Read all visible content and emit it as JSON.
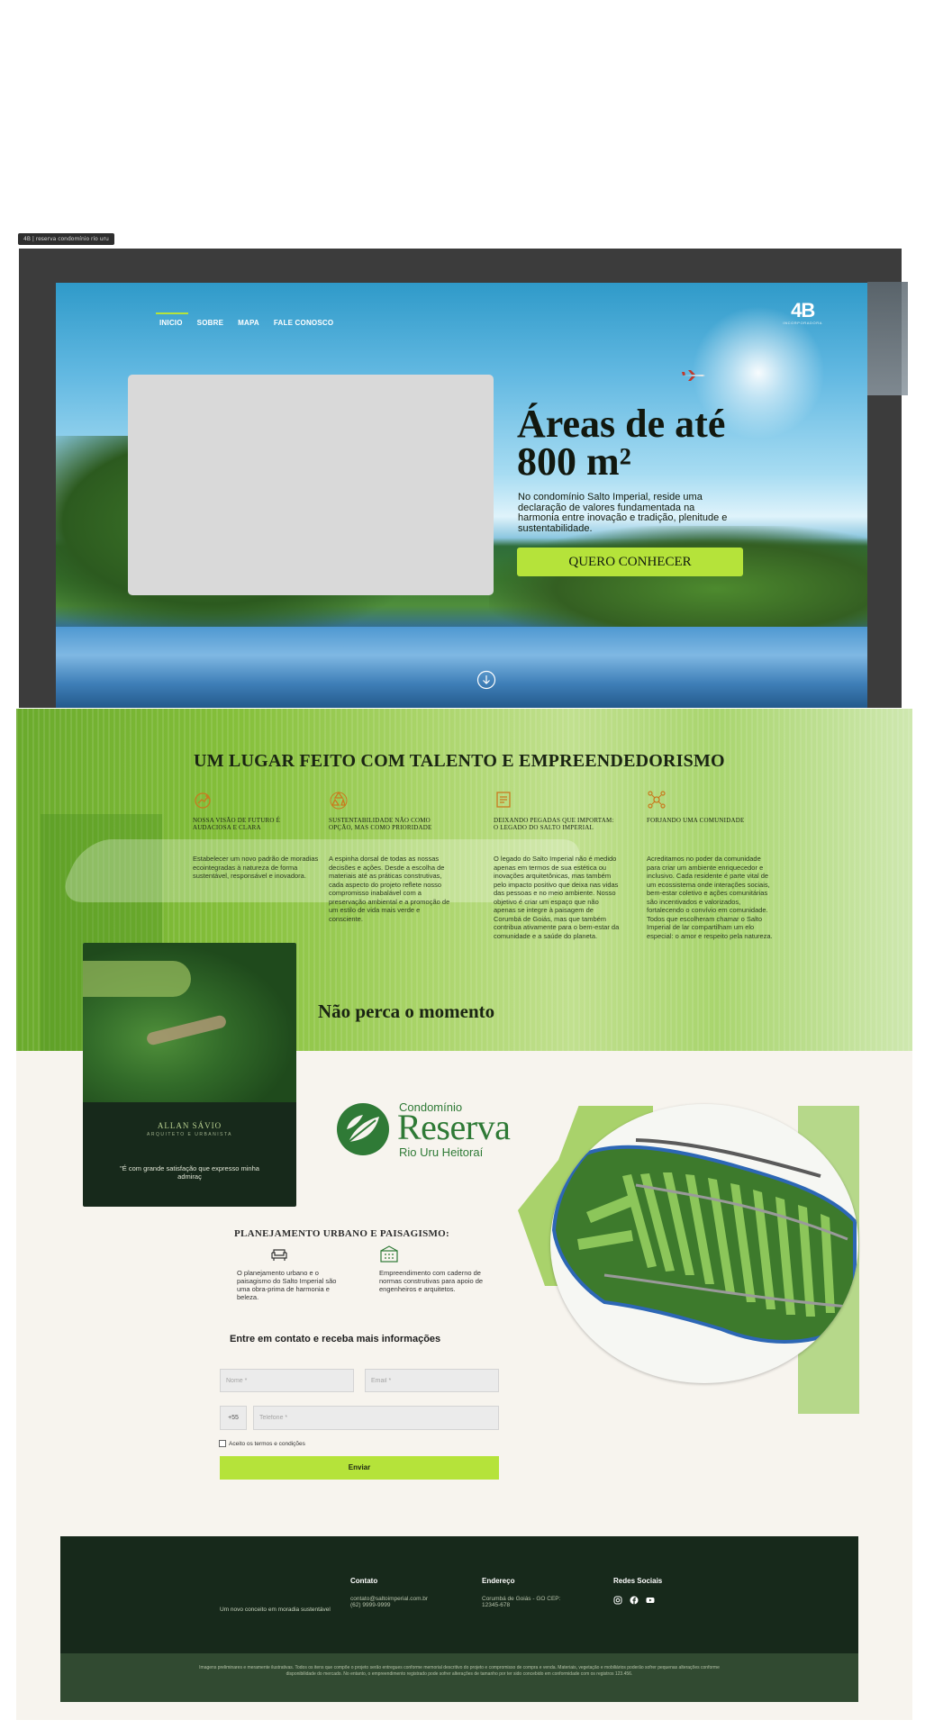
{
  "frame_tag": "4B | reserva condomínio rio uru",
  "nav": {
    "items": [
      {
        "label": "INICIO",
        "active": true
      },
      {
        "label": "SOBRE",
        "active": false
      },
      {
        "label": "MAPA",
        "active": false
      },
      {
        "label": "FALE CONOSCO",
        "active": false
      }
    ]
  },
  "logo": {
    "mark": "4B",
    "sub": "INCORPORADORA"
  },
  "hero": {
    "title_line1": "Áreas de até",
    "title_line2": "800 m²",
    "text": "No condomínio Salto Imperial, reside uma declaração de valores fundamentada na harmonia entre inovação e tradição, plenitude e sustentabilidade.",
    "cta": "QUERO CONHECER"
  },
  "talent": {
    "title": "UM LUGAR FEITO COM TALENTO E EMPREENDEDORISMO",
    "pillars": [
      {
        "icon": "growth-icon",
        "title": "NOSSA VISÃO DE FUTURO É AUDACIOSA E CLARA",
        "body": "Estabelecer um novo padrão de moradias ecointegradas à natureza de forma sustentável, responsável e inovadora."
      },
      {
        "icon": "recycle-icon",
        "title": "SUSTENTABILIDADE NÃO COMO OPÇÃO, MAS COMO PRIORIDADE",
        "body": "A espinha dorsal de todas as nossas decisões e ações. Desde a escolha de materiais até as práticas construtivas, cada aspecto do projeto reflete nosso compromisso inabalável com a preservação ambiental e a promoção de um estilo de vida mais verde e consciente."
      },
      {
        "icon": "document-icon",
        "title": "DEIXANDO PEGADAS QUE IMPORTAM: O LEGADO DO SALTO IMPERIAL",
        "body": "O legado do Salto Imperial não é medido apenas em termos de sua estética ou inovações arquitetônicas, mas também pelo impacto positivo que deixa nas vidas das pessoas e no meio ambiente. Nosso objetivo é criar um espaço que não apenas se integre à paisagem de Corumbá de Goiás, mas que também contribua ativamente para o bem-estar da comunidade e a saúde do planeta."
      },
      {
        "icon": "community-icon",
        "title": "FORJANDO UMA COMUNIDADE",
        "body": "Acreditamos no poder da comunidade para criar um ambiente enriquecedor e inclusivo. Cada residente é parte vital de um ecossistema onde interações sociais, bem-estar coletivo e ações comunitárias são incentivados e valorizados, fortalecendo o convívio em comunidade. Todos que escolheram chamar o Salto Imperial de lar compartilham um elo especial: o amor e respeito pela natureza."
      }
    ],
    "moment_title": "Não perca o momento"
  },
  "testimonial": {
    "name": "ALLAN SÁVIO",
    "role": "ARQUITETO E URBANISTA",
    "quote": "\"É com grande satisfação que expresso minha admiraç"
  },
  "brand": {
    "line1": "Condomínio",
    "line2": "Reserva",
    "line3": "Rio Uru Heitoraí",
    "color": "#2f7a36"
  },
  "planning": {
    "title": "PLANEJAMENTO URBANO E PAISAGISMO:",
    "items": [
      {
        "icon": "sofa-icon",
        "text": "O planejamento urbano e o paisagismo do Salto Imperial são uma obra-prima de harmonia e beleza."
      },
      {
        "icon": "building-icon",
        "text": "Empreendimento com caderno de normas construtivas para apoio de engenheiros e arquitetos."
      }
    ]
  },
  "form": {
    "title": "Entre em contato e receba mais informações",
    "name_placeholder": "Nome *",
    "email_placeholder": "Email *",
    "phone_prefix": "+55",
    "phone_placeholder": "Telefone *",
    "terms": "Aceito os termos e condições",
    "submit": "Enviar"
  },
  "footer": {
    "tagline": "Um novo conceito em moradia sustentável",
    "contact_title": "Contato",
    "contact_email": "contato@saltoimperial.com.br",
    "contact_phone": "(62) 9999-9999",
    "address_title": "Endereço",
    "address_line1": "Corumbá de Goiás - GO CEP:",
    "address_line2": "12345-678",
    "social_title": "Redes Sociais",
    "legal": "Imagens preliminares e meramente ilustrativas. Todos os itens que compõe o projeto serão entregues conforme memorial descritivo do projeto e compromisso de compra e venda. Materiais, vegetação e mobiliários poderão sofrer pequenas alterações conforme disponibilidade do mercado. No entanto, o empreendimento registrado pode sofrer alterações de tamanho por ter sido concebido em conformidade com os registros 123.456."
  },
  "colors": {
    "accent": "#b5e33a",
    "dark_green": "#17291b",
    "frame": "#3c3c3c"
  }
}
